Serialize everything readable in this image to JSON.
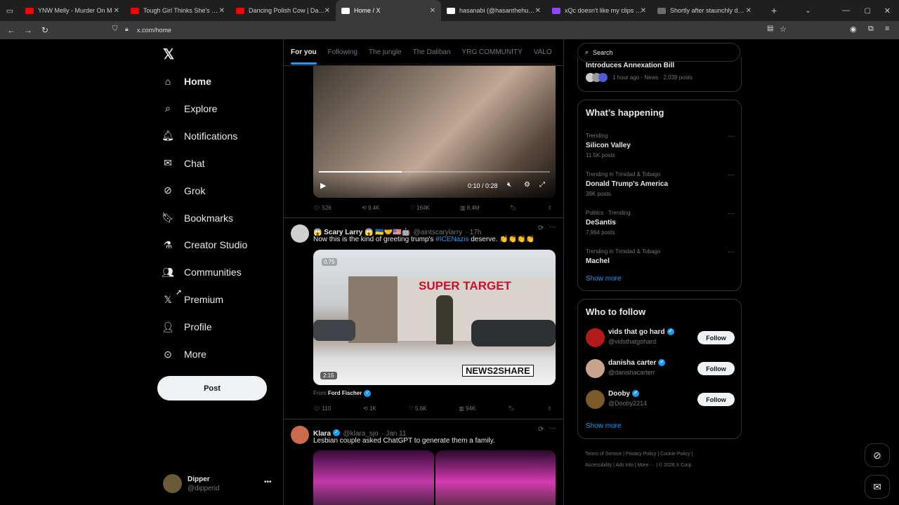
{
  "browser": {
    "tabs": [
      {
        "title": "YNW Melly - Murder On M",
        "color": "#ff0000"
      },
      {
        "title": "Tough Girl Thinks She's Untouc",
        "color": "#ff0000"
      },
      {
        "title": "Dancing Polish Cow | Dancing",
        "color": "#ff0000"
      },
      {
        "title": "Home / X",
        "color": "#ffffff",
        "active": true
      },
      {
        "title": "hasanabi (@hasanthehun) / X",
        "color": "#ffffff"
      },
      {
        "title": "xQc doesn't like my clips - Twit",
        "color": "#9146ff"
      },
      {
        "title": "Shortly after staunchly denying",
        "color": "#6b6b6b"
      }
    ],
    "url": "x.com/home"
  },
  "nav": {
    "items": [
      {
        "label": "Home",
        "icon": "home-icon"
      },
      {
        "label": "Explore",
        "icon": "search-icon"
      },
      {
        "label": "Notifications",
        "icon": "bell-icon"
      },
      {
        "label": "Chat",
        "icon": "mail-icon"
      },
      {
        "label": "Grok",
        "icon": "grok-icon"
      },
      {
        "label": "Bookmarks",
        "icon": "bookmark-icon"
      },
      {
        "label": "Creator Studio",
        "icon": "flask-icon"
      },
      {
        "label": "Communities",
        "icon": "people-icon"
      },
      {
        "label": "Premium",
        "icon": "x-logo-icon"
      },
      {
        "label": "Profile",
        "icon": "person-icon"
      },
      {
        "label": "More",
        "icon": "more-circle-icon"
      }
    ],
    "post_label": "Post",
    "account": {
      "name": "Dipper",
      "handle": "@dipperid"
    }
  },
  "feed": {
    "tabs": [
      "For you",
      "Following",
      "The jungle",
      "The Daliban",
      "YRG COMMUNITY",
      "VALO"
    ],
    "video1": {
      "time": "0:10 / 0:28",
      "progress": 0.36
    },
    "tweet0_actions": {
      "replies": "526",
      "reposts": "9.4K",
      "likes": "164K",
      "views": "8.4M"
    },
    "tweet1": {
      "name": "😱 Scary Larry 😱 🇺🇦🤝🇺🇸🤖",
      "handle": "@aintscarylarry",
      "time": "· 17h",
      "text_before": "Now this is the kind of greeting trump's ",
      "hashtag": "#ICENazis",
      "text_after": " deserve. 👏👏👏👏",
      "video_speed": "0.75",
      "video_duration": "2:15",
      "watermark": "NEWS2SHARE",
      "store_sign": "SUPER TARGET",
      "from_label": "From",
      "from_name": "Ford Fischer",
      "actions": {
        "replies": "110",
        "reposts": "1K",
        "likes": "5.6K",
        "views": "94K"
      }
    },
    "tweet2": {
      "name": "Klara",
      "handle": "@klara_sjo",
      "time": "· Jan 11",
      "text": "Lesbian couple asked ChatGPT to generate them a family."
    }
  },
  "sidebar": {
    "search_placeholder": "Search",
    "news_partial_title": "Introduces Annexation Bill",
    "news_meta": "1 hour ago · News · 2,039 posts",
    "happening_title": "What’s happening",
    "trends": [
      {
        "meta": "Trending",
        "name": "Silicon Valley",
        "posts": "11.5K posts"
      },
      {
        "meta": "Trending in Trinidad & Tobago",
        "name": "Donald Trump's America",
        "posts": "39K posts"
      },
      {
        "meta": "Politics · Trending",
        "name": "DeSantis",
        "posts": "7,964 posts"
      },
      {
        "meta": "Trending in Trinidad & Tobago",
        "name": "Machel",
        "posts": ""
      }
    ],
    "show_more": "Show more",
    "who_title": "Who to follow",
    "follows": [
      {
        "name": "vids that go hard",
        "handle": "@vidsthatgohard",
        "color": "#b31b1b"
      },
      {
        "name": "danisha carter",
        "handle": "@danishacarterr",
        "color": "#c9a48c"
      },
      {
        "name": "Dooby",
        "handle": "@Dooby2214",
        "color": "#7a5a2a"
      }
    ],
    "follow_label": "Follow",
    "footer_line1": "Terms of Service  |  Privacy Policy  |  Cookie Policy  |",
    "footer_line2": "Accessibility  |  Ads info  |  More ···  |  © 2026 X Corp."
  }
}
